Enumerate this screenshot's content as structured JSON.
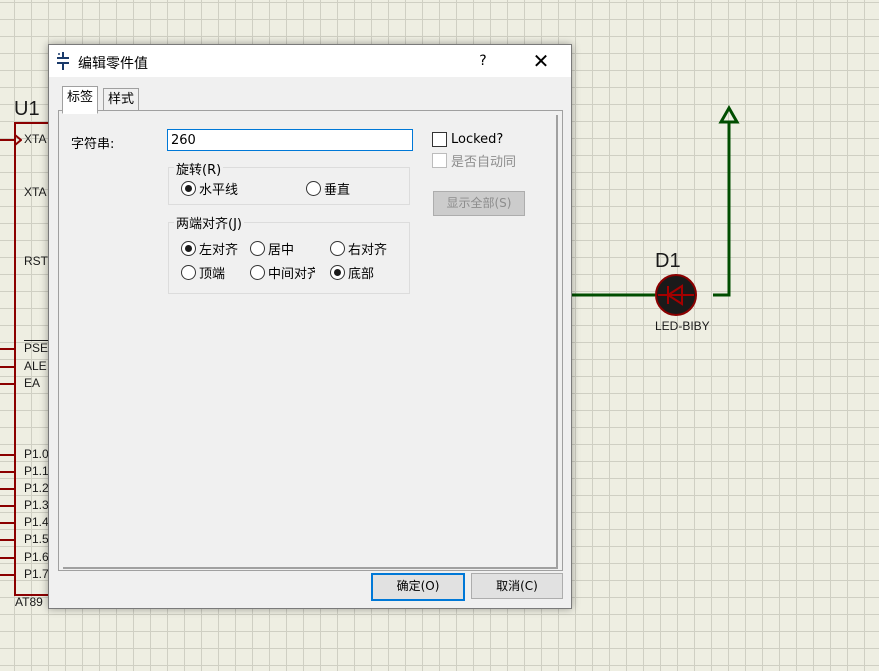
{
  "schematic": {
    "chip_ref": "U1",
    "chip_part": "AT89",
    "pins": [
      "XTA",
      "XTA",
      "RST",
      "PSE",
      "ALE",
      "EA",
      "P1.0",
      "P1.1",
      "P1.2",
      "P1.3",
      "P1.4",
      "P1.5",
      "P1.6",
      "P1.7"
    ],
    "led_ref": "D1",
    "led_part": "LED-BIBY",
    "wire_color": "#004d00",
    "component_color": "#8b0000"
  },
  "dialog": {
    "title": "编辑零件值",
    "help_label": "?",
    "close_label": "✕",
    "tabs": [
      "标签",
      "样式"
    ],
    "string_label": "字符串:",
    "string_value": "260",
    "rotation": {
      "title": "旋转(R)",
      "options": [
        "水平线",
        "垂直"
      ],
      "selected": "水平线"
    },
    "alignment": {
      "title": "两端对齐(J)",
      "horizontal": [
        "左对齐",
        "居中",
        "右对齐"
      ],
      "vertical": [
        "顶端",
        "中间对齐",
        "底部"
      ],
      "selected_horizontal": "左对齐",
      "selected_vertical": "底部"
    },
    "locked_label": "Locked?",
    "locked_checked": false,
    "auto_label": "是否自动同",
    "auto_enabled": false,
    "show_all_label": "显示全部(S)",
    "ok_label": "确定(O)",
    "cancel_label": "取消(C)",
    "accent_color": "#0078d7"
  }
}
